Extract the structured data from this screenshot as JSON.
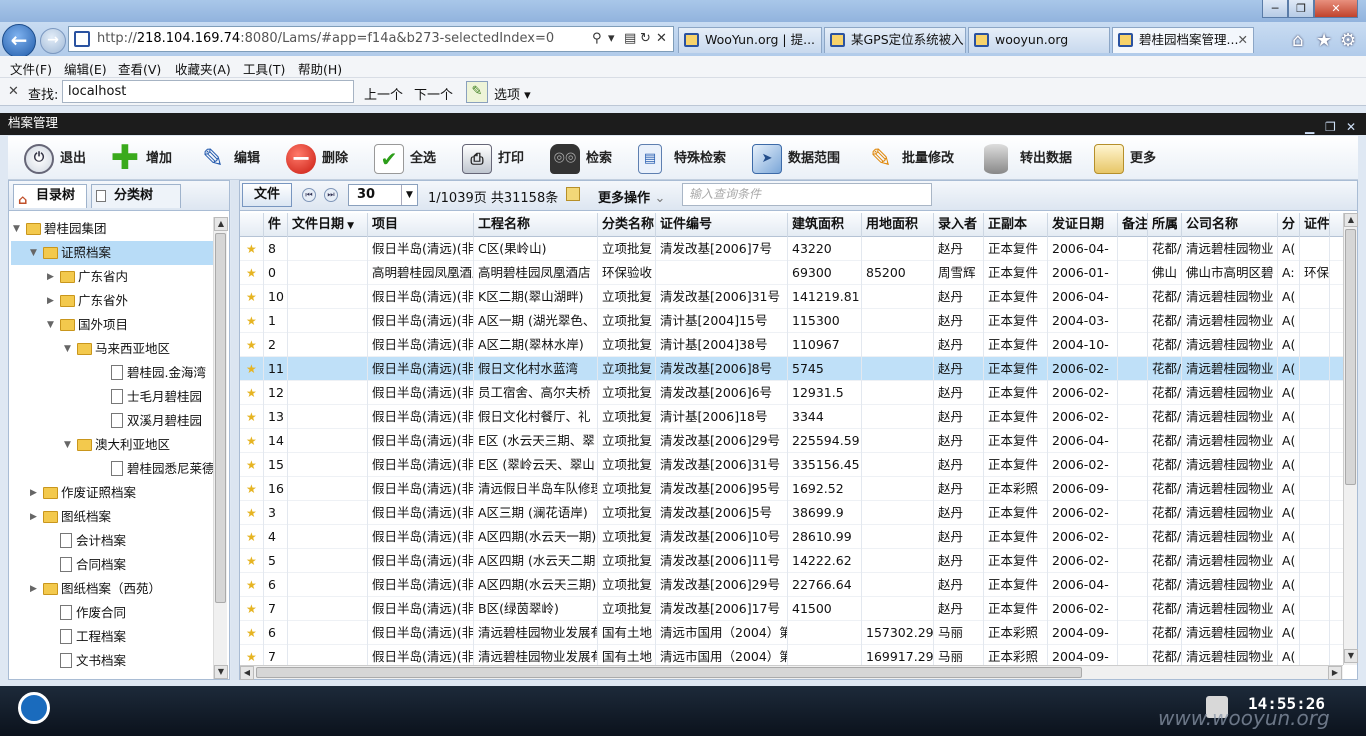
{
  "browser": {
    "url_prefix": "http://",
    "url_host": "218.104.169.74",
    "url_rest": ":8080/Lams/#app=f14a&b273-selectedIndex=0",
    "tabs": [
      {
        "label": "WooYun.org | 提...",
        "active": false
      },
      {
        "label": "某GPS定位系统被入...",
        "active": false
      },
      {
        "label": "wooyun.org",
        "active": false
      },
      {
        "label": "碧桂园档案管理...",
        "active": true
      }
    ],
    "window_controls": [
      "─",
      "❐",
      "✕"
    ]
  },
  "menu": [
    "文件(F)",
    "编辑(E)",
    "查看(V)",
    "收藏夹(A)",
    "工具(T)",
    "帮助(H)"
  ],
  "findbar": {
    "label": "查找:",
    "value": "localhost",
    "prev": "上一个",
    "next": "下一个",
    "options": "选项"
  },
  "app": {
    "title": "档案管理",
    "toolbar": [
      {
        "label": "退出",
        "icon": "power-icon"
      },
      {
        "label": "增加",
        "icon": "plus-icon"
      },
      {
        "label": "编辑",
        "icon": "pencil-icon"
      },
      {
        "label": "删除",
        "icon": "minus-icon"
      },
      {
        "label": "全选",
        "icon": "checklist-icon"
      },
      {
        "label": "打印",
        "icon": "printer-icon"
      },
      {
        "label": "检索",
        "icon": "binoculars-icon"
      },
      {
        "label": "特殊检索",
        "icon": "document-search-icon"
      },
      {
        "label": "数据范围",
        "icon": "send-icon"
      },
      {
        "label": "批量修改",
        "icon": "batch-edit-icon"
      },
      {
        "label": "转出数据",
        "icon": "database-icon"
      },
      {
        "label": "更多",
        "icon": "folder-icon"
      }
    ]
  },
  "left": {
    "tabs": [
      "目录树",
      "分类树"
    ],
    "tree": [
      {
        "label": "碧桂园集团",
        "level": 0,
        "type": "folder",
        "toggle": "▼"
      },
      {
        "label": "证照档案",
        "level": 1,
        "type": "folder",
        "toggle": "▼",
        "selected": true
      },
      {
        "label": "广东省内",
        "level": 2,
        "type": "folder",
        "toggle": "▶"
      },
      {
        "label": "广东省外",
        "level": 2,
        "type": "folder",
        "toggle": "▶"
      },
      {
        "label": "国外项目",
        "level": 2,
        "type": "folder",
        "toggle": "▼"
      },
      {
        "label": "马来西亚地区",
        "level": 3,
        "type": "folder",
        "toggle": "▼"
      },
      {
        "label": "碧桂园.金海湾",
        "level": 4,
        "type": "doc",
        "toggle": ""
      },
      {
        "label": "士毛月碧桂园",
        "level": 4,
        "type": "doc",
        "toggle": ""
      },
      {
        "label": "双溪月碧桂园",
        "level": 4,
        "type": "doc",
        "toggle": ""
      },
      {
        "label": "澳大利亚地区",
        "level": 3,
        "type": "folder",
        "toggle": "▼"
      },
      {
        "label": "碧桂园悉尼莱德花园",
        "level": 4,
        "type": "doc",
        "toggle": ""
      },
      {
        "label": "作废证照档案",
        "level": 1,
        "type": "folder",
        "toggle": "▶"
      },
      {
        "label": "图纸档案",
        "level": 1,
        "type": "folder",
        "toggle": "▶"
      },
      {
        "label": "会计档案",
        "level": 1,
        "type": "doc",
        "toggle": ""
      },
      {
        "label": "合同档案",
        "level": 1,
        "type": "doc",
        "toggle": ""
      },
      {
        "label": "图纸档案（西苑）",
        "level": 1,
        "type": "folder",
        "toggle": "▶"
      },
      {
        "label": "作废合同",
        "level": 1,
        "type": "doc",
        "toggle": ""
      },
      {
        "label": "工程档案",
        "level": 1,
        "type": "doc",
        "toggle": ""
      },
      {
        "label": "文书档案",
        "level": 1,
        "type": "doc",
        "toggle": ""
      }
    ]
  },
  "grid": {
    "file_button": "文件",
    "page_size": "30",
    "page_info": "1/1039页 共31158条",
    "more_ops": "更多操作",
    "query_placeholder": "输入查询条件",
    "columns": [
      "件",
      "文件日期",
      "项目",
      "工程名称",
      "分类名称",
      "证件编号",
      "建筑面积",
      "用地面积",
      "录入者",
      "正副本",
      "发证日期",
      "备注",
      "所属",
      "公司名称",
      "分",
      "证件"
    ],
    "rows": [
      [
        "8",
        "",
        "假日半岛(清远)(非",
        "C区(果岭山)",
        "立项批复",
        "清发改基[2006]7号",
        "43220",
        "",
        "赵丹",
        "正本复件",
        "2006-04-",
        "",
        "花都/",
        "清远碧桂园物业",
        "A(",
        ""
      ],
      [
        "0",
        "",
        "高明碧桂园凤凰酒店",
        "高明碧桂园凤凰酒店",
        "环保验收",
        "",
        "69300",
        "85200",
        "周雪辉",
        "正本复件",
        "2006-01-",
        "",
        "佛山",
        "佛山市高明区碧",
        "A:",
        "环保"
      ],
      [
        "10",
        "",
        "假日半岛(清远)(非",
        "K区二期(翠山湖畔)",
        "立项批复",
        "清发改基[2006]31号",
        "141219.81",
        "",
        "赵丹",
        "正本复件",
        "2006-04-",
        "",
        "花都/",
        "清远碧桂园物业",
        "A(",
        ""
      ],
      [
        "1",
        "",
        "假日半岛(清远)(非",
        "A区一期 (湖光翠色、",
        "立项批复",
        "清计基[2004]15号",
        "115300",
        "",
        "赵丹",
        "正本复件",
        "2004-03-",
        "",
        "花都/",
        "清远碧桂园物业",
        "A(",
        ""
      ],
      [
        "2",
        "",
        "假日半岛(清远)(非",
        "A区二期(翠林水岸)",
        "立项批复",
        "清计基[2004]38号",
        "110967",
        "",
        "赵丹",
        "正本复件",
        "2004-10-",
        "",
        "花都/",
        "清远碧桂园物业",
        "A(",
        ""
      ],
      [
        "11",
        "",
        "假日半岛(清远)(非",
        "假日文化村水蓝湾",
        "立项批复",
        "清发改基[2006]8号",
        "5745",
        "",
        "赵丹",
        "正本复件",
        "2006-02-",
        "",
        "花都/",
        "清远碧桂园物业",
        "A(",
        ""
      ],
      [
        "12",
        "",
        "假日半岛(清远)(非",
        "员工宿舍、高尔夫桥",
        "立项批复",
        "清发改基[2006]6号",
        "12931.5",
        "",
        "赵丹",
        "正本复件",
        "2006-02-",
        "",
        "花都/",
        "清远碧桂园物业",
        "A(",
        ""
      ],
      [
        "13",
        "",
        "假日半岛(清远)(非",
        "假日文化村餐厅、礼",
        "立项批复",
        "清计基[2006]18号",
        "3344",
        "",
        "赵丹",
        "正本复件",
        "2006-02-",
        "",
        "花都/",
        "清远碧桂园物业",
        "A(",
        ""
      ],
      [
        "14",
        "",
        "假日半岛(清远)(非",
        "E区 (水云天三期、翠",
        "立项批复",
        "清发改基[2006]29号",
        "225594.59",
        "",
        "赵丹",
        "正本复件",
        "2006-04-",
        "",
        "花都/",
        "清远碧桂园物业",
        "A(",
        ""
      ],
      [
        "15",
        "",
        "假日半岛(清远)(非",
        "E区 (翠岭云天、翠山",
        "立项批复",
        "清发改基[2006]31号",
        "335156.45",
        "",
        "赵丹",
        "正本复件",
        "2006-02-",
        "",
        "花都/",
        "清远碧桂园物业",
        "A(",
        ""
      ],
      [
        "16",
        "",
        "假日半岛(清远)(非",
        "清远假日半岛车队修理",
        "立项批复",
        "清发改基[2006]95号",
        "1692.52",
        "",
        "赵丹",
        "正本彩照",
        "2006-09-",
        "",
        "花都/",
        "清远碧桂园物业",
        "A(",
        ""
      ],
      [
        "3",
        "",
        "假日半岛(清远)(非",
        "A区三期 (澜花语岸)",
        "立项批复",
        "清发改基[2006]5号",
        "38699.9",
        "",
        "赵丹",
        "正本复件",
        "2006-02-",
        "",
        "花都/",
        "清远碧桂园物业",
        "A(",
        ""
      ],
      [
        "4",
        "",
        "假日半岛(清远)(非",
        "A区四期(水云天一期)",
        "立项批复",
        "清发改基[2006]10号",
        "28610.99",
        "",
        "赵丹",
        "正本复件",
        "2006-02-",
        "",
        "花都/",
        "清远碧桂园物业",
        "A(",
        ""
      ],
      [
        "5",
        "",
        "假日半岛(清远)(非",
        "A区四期 (水云天二期",
        "立项批复",
        "清发改基[2006]11号",
        "14222.62",
        "",
        "赵丹",
        "正本复件",
        "2006-02-",
        "",
        "花都/",
        "清远碧桂园物业",
        "A(",
        ""
      ],
      [
        "6",
        "",
        "假日半岛(清远)(非",
        "A区四期(水云天三期)",
        "立项批复",
        "清发改基[2006]29号",
        "22766.64",
        "",
        "赵丹",
        "正本复件",
        "2006-04-",
        "",
        "花都/",
        "清远碧桂园物业",
        "A(",
        ""
      ],
      [
        "7",
        "",
        "假日半岛(清远)(非",
        "B区(绿茵翠岭)",
        "立项批复",
        "清发改基[2006]17号",
        "41500",
        "",
        "赵丹",
        "正本复件",
        "2006-02-",
        "",
        "花都/",
        "清远碧桂园物业",
        "A(",
        ""
      ],
      [
        "6",
        "",
        "假日半岛(清远)(非",
        "清远碧桂园物业发展有",
        "国有土地",
        "清远市国用（2004）第",
        "",
        "157302.29",
        "马丽",
        "正本彩照",
        "2004-09-",
        "",
        "花都/",
        "清远碧桂园物业",
        "A(",
        ""
      ],
      [
        "7",
        "",
        "假日半岛(清远)(非",
        "清远碧桂园物业发展有",
        "国有土地",
        "清远市国用（2004）第",
        "",
        "169917.29",
        "马丽",
        "正本彩照",
        "2004-09-",
        "",
        "花都/",
        "清远碧桂园物业",
        "A(",
        ""
      ]
    ],
    "selected_row": 5
  },
  "taskbar": {
    "clock": "14:55:26",
    "watermark": "www.wooyun.org"
  }
}
